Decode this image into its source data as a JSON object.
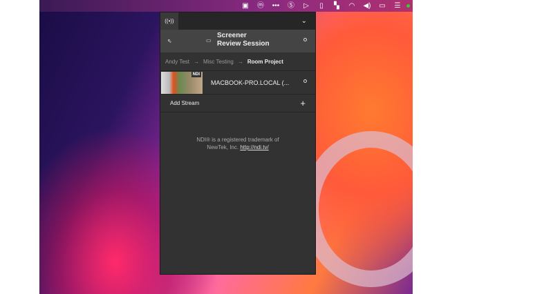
{
  "menubar": {
    "icons": [
      "app-icon",
      "m-icon",
      "dots-icon",
      "s-icon",
      "play-icon",
      "badge-icon",
      "layout-icon",
      "wifi-icon",
      "volume-icon",
      "battery-icon",
      "control-center-icon"
    ]
  },
  "panel": {
    "broadcast_icon": "((•))",
    "chevron": "⌄",
    "session_title_line1": "Screener",
    "session_title_line2": "Review Session",
    "breadcrumb": [
      "Andy Test",
      "Misc Testing",
      "Room Project"
    ],
    "stream": {
      "badge": "NDI",
      "name": "MACBOOK-PRO.LOCAL (..."
    },
    "add_stream": "Add Stream",
    "add_symbol": "+",
    "notice_line1": "NDI® is a registered trademark of",
    "notice_line2": "NewTek, Inc.",
    "notice_link": "http://ndi.tv/"
  }
}
